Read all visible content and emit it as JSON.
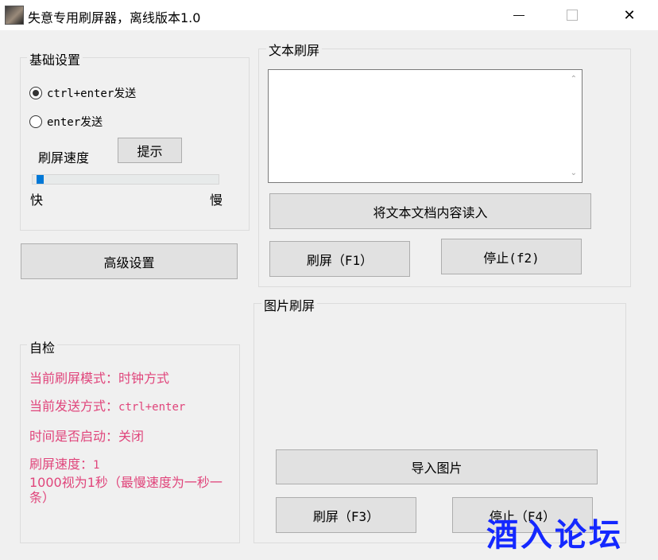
{
  "window": {
    "title": "失意专用刷屏器，离线版本1.0"
  },
  "basic": {
    "group_label": "基础设置",
    "radio_ctrl_enter": "ctrl+enter发送",
    "radio_enter": "enter发送",
    "ctrl_enter_checked": true,
    "speed_label": "刷屏速度",
    "hint_button": "提示",
    "slider_fast": "快",
    "slider_slow": "慢",
    "slider_value_fraction": 0.02
  },
  "advanced_button": "高级设置",
  "selfcheck": {
    "group_label": "自检",
    "mode": "当前刷屏模式：时钟方式",
    "send_prefix": "当前发送方式：",
    "send_value": "ctrl+enter",
    "timer": "时间是否启动：关闭",
    "speed_prefix": "刷屏速度：",
    "speed_value": "1",
    "note": "1000视为1秒（最慢速度为一秒一条）"
  },
  "text_flood": {
    "group_label": "文本刷屏",
    "textarea_value": "",
    "load_button": "将文本文档内容读入",
    "start_button": "刷屏（F1）",
    "stop_button": "停止(f2)"
  },
  "image_flood": {
    "group_label": "图片刷屏",
    "import_button": "导入图片",
    "start_button": "刷屏（F3）",
    "stop_button": "停止（F4）"
  },
  "watermark": "酒入论坛",
  "icons": {
    "close": "✕",
    "scroll_up": "⌃",
    "scroll_down": "⌄"
  }
}
